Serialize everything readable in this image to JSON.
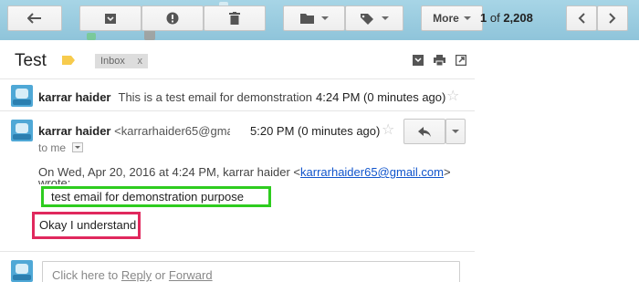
{
  "toolbar": {
    "icons": [
      "back-arrow-icon",
      "archive-icon",
      "report-spam-icon",
      "trash-icon",
      "folder-icon",
      "label-icon",
      "chevron-left-icon",
      "chevron-right-icon"
    ],
    "more_label": "More",
    "pager_current": "1",
    "pager_of": "of",
    "pager_total": "2,208"
  },
  "thread": {
    "subject": "Test",
    "label_chip": "Inbox",
    "label_chip_close": "x",
    "top_icons": [
      "expand-all-icon",
      "print-icon",
      "new-window-icon"
    ]
  },
  "message1": {
    "sender": "karrar haider",
    "snippet": "This is a test email for demonstration p",
    "time": "4:24 PM (0 minutes ago)"
  },
  "message2": {
    "sender": "karrar haider",
    "email": "<karrarhaider65@gmai",
    "time": "5:20 PM (0 minutes ago)",
    "to": "to me",
    "quote_header": "On Wed, Apr 20, 2016 at 4:24 PM, karrar haider <",
    "quote_email": "karrarhaider65@gmail.com",
    "quote_header_end": ">",
    "wrote": "wrote:",
    "quoted_text": "test email for demonstration purpose",
    "body": "Okay I understand"
  },
  "compose": {
    "prefix": "Click here to ",
    "reply": "Reply",
    "or": " or ",
    "forward": "Forward"
  },
  "colors": {
    "toolbar_bg": "#98cbe0",
    "highlight_green": "#2ecc1f",
    "highlight_pink": "#e0285d",
    "link": "#1155cc",
    "label_yellow": "#f7cb4d"
  }
}
